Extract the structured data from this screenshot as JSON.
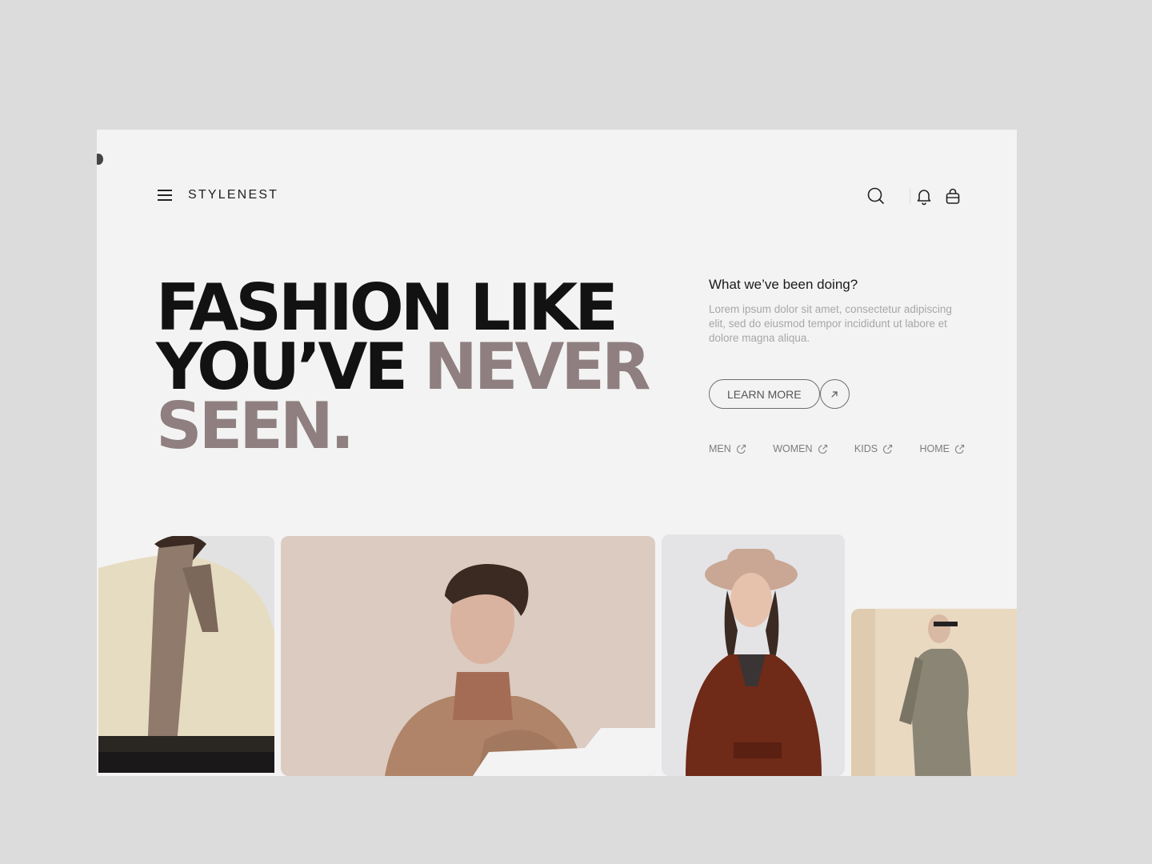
{
  "brand": {
    "name": "STYLENEST"
  },
  "nav": {
    "icons": [
      "menu-icon",
      "search-icon",
      "bell-icon",
      "shopping-bag-icon"
    ]
  },
  "hero": {
    "line1": "FASHION LIKE",
    "line2_dark": "YOU’VE",
    "line2_accent": "NEVER",
    "line3_accent": "SEEN."
  },
  "side": {
    "title": "What we’ve been doing?",
    "text": "Lorem ipsum dolor sit amet, consectetur adipiscing elit, sed do eiusmod tempor incididunt ut labore et dolore magna aliqua.",
    "cta_label": "LEARN MORE"
  },
  "categories": [
    {
      "label": "MEN"
    },
    {
      "label": "WOMEN"
    },
    {
      "label": "KIDS"
    },
    {
      "label": "HOME"
    }
  ],
  "colors": {
    "background": "#dcdcdc",
    "panel": "#f3f3f3",
    "headline_dark": "#121212",
    "headline_accent": "#8f7f80",
    "muted_text": "#a7a7a7"
  },
  "gallery": [
    {
      "subject": "man in cream sweater with brown scarf"
    },
    {
      "subject": "man in turtleneck and camel coat"
    },
    {
      "subject": "woman in hat and brown trench coat"
    },
    {
      "subject": "woman in grey suit walking"
    }
  ]
}
